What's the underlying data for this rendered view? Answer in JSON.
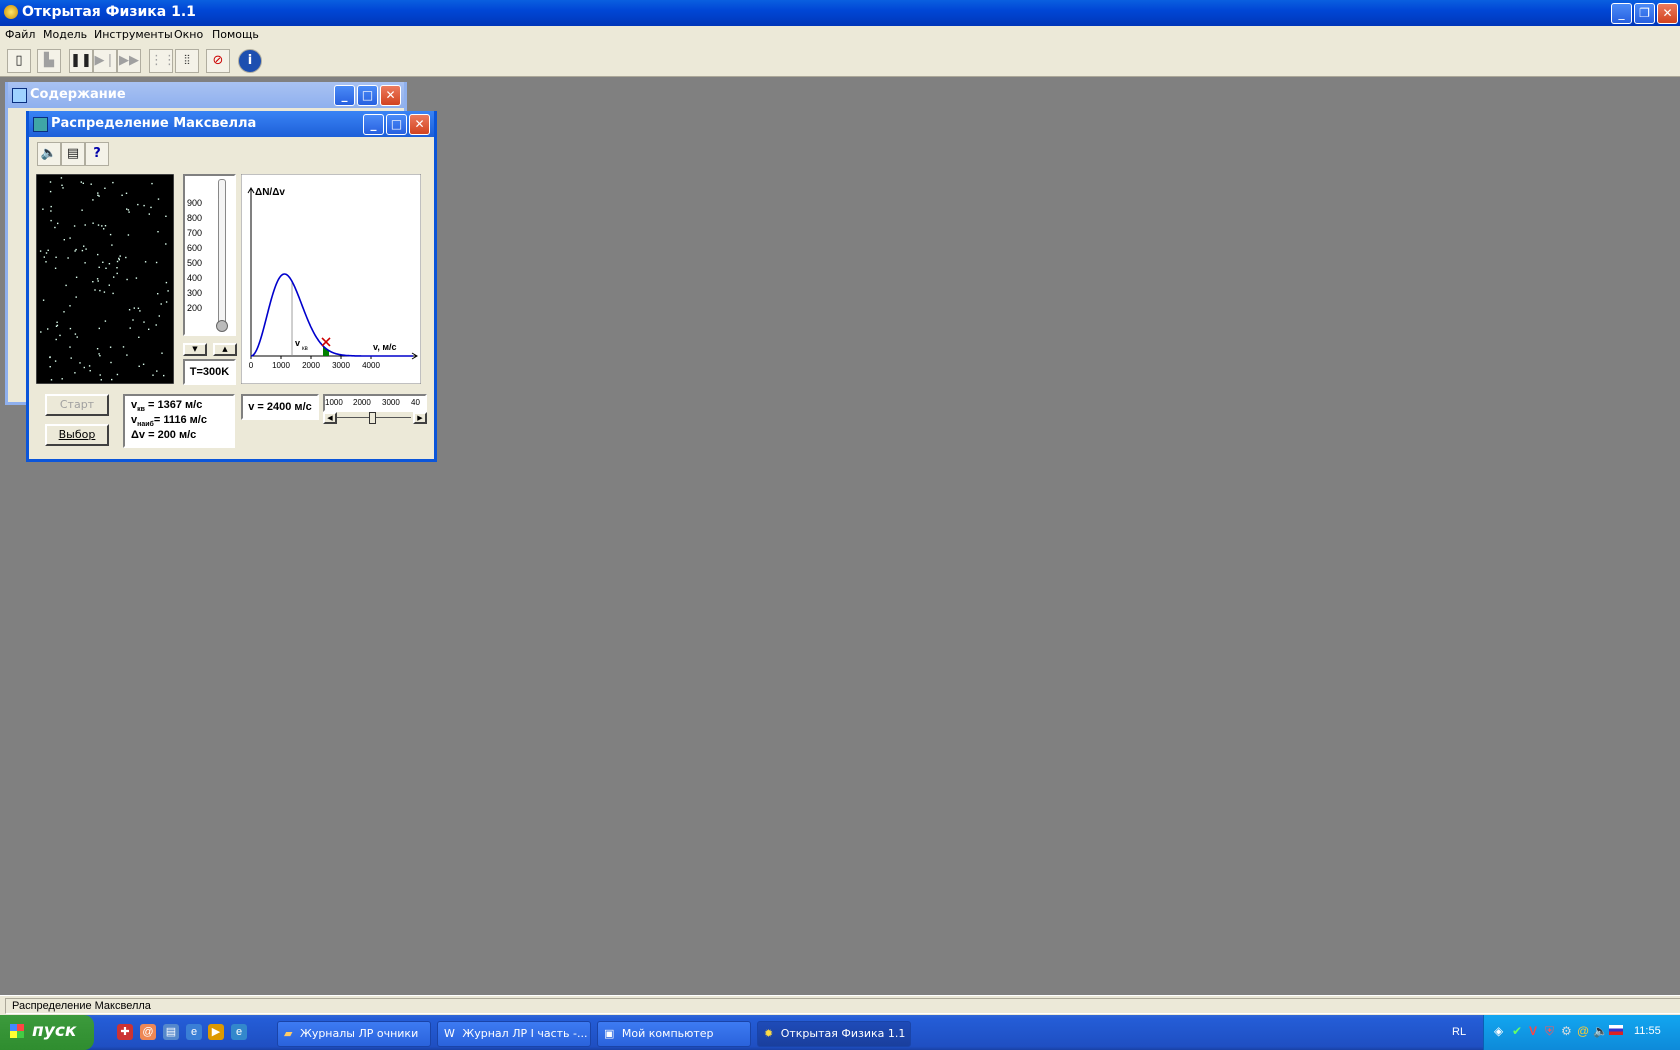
{
  "app": {
    "title": "Открытая Физика 1.1"
  },
  "menu": [
    "Файл",
    "Модель",
    "Инструменты",
    "Окно",
    "Помощь"
  ],
  "toolbar_icons": [
    "door-icon",
    "exit-model-icon",
    "pause-icon",
    "step-icon",
    "fast-forward-icon",
    "skip-icon",
    "frames-icon",
    "sound-off-icon",
    "info-icon"
  ],
  "contents_window": {
    "title": "Содержание"
  },
  "maxwell_window": {
    "title": "Распределение Максвелла",
    "tool_icons": [
      "speaker-icon",
      "page-icon",
      "help-icon"
    ],
    "thermometer_ticks": [
      "900",
      "800",
      "700",
      "600",
      "500",
      "400",
      "300",
      "200"
    ],
    "temperature_label": "T=300K",
    "start_button": "Старт",
    "select_button": "Выбор",
    "v_sq_label": "v",
    "v_sq_sub": "кв",
    "v_sq_value": "= 1367 м/с",
    "v_prob_label": "v",
    "v_prob_sub": "наиб",
    "v_prob_value": "= 1116 м/с",
    "dv_label": "Δv",
    "dv_value": "= 200 м/с",
    "v_readout": "v = 2400 м/с",
    "scale_ticks": [
      "1000",
      "2000",
      "3000",
      "40"
    ]
  },
  "chart_data": {
    "type": "line",
    "title": "",
    "ylabel": "ΔN/Δv",
    "xlabel": "v, м/с",
    "marker_label": "v",
    "marker_sub": "кв",
    "x_ticks": [
      "0",
      "1000",
      "2000",
      "3000",
      "4000"
    ],
    "xlim": [
      0,
      5400
    ],
    "temperature_K": 300,
    "peak_v": 1116,
    "marked_v": 1367,
    "selected_v": 2400,
    "selected_dv": 200,
    "curve_color": "#0000cc",
    "band_color": "#008000",
    "selector_color": "#cc0000"
  },
  "status": {
    "text": "Распределение Максвелла"
  },
  "taskbar": {
    "start": "пуск",
    "tasks": [
      "Журналы ЛР очники",
      "Журнал ЛР I часть -...",
      "Мой компьютер",
      "Открытая Физика 1.1"
    ],
    "lang": "RL",
    "clock": "11:55"
  }
}
